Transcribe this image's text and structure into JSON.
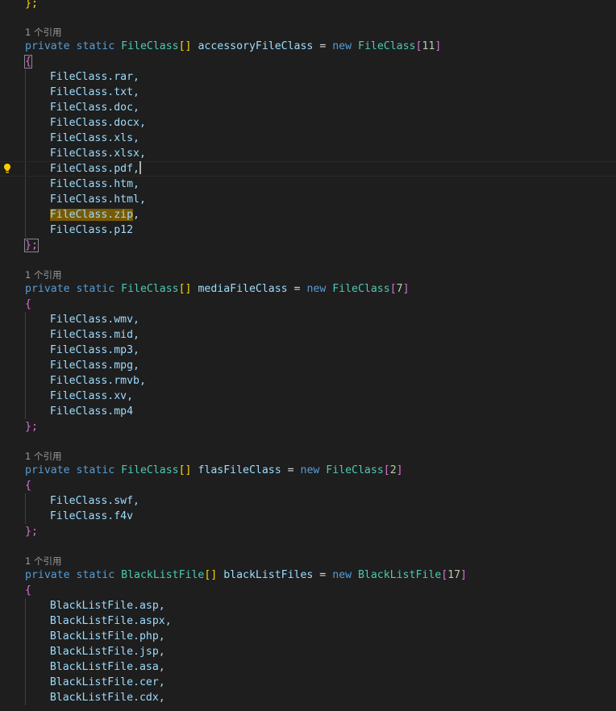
{
  "codelens": "1 个引用",
  "top_fragment": "};",
  "blocks": [
    {
      "decl": {
        "kw1": "private",
        "kw2": "static",
        "type": "FileClass",
        "arr": "[]",
        "name": "accessoryFileClass",
        "eq": "=",
        "kwnew": "new",
        "type2": "FileClass",
        "size": "11"
      },
      "open": "{",
      "items": [
        "FileClass.rar,",
        "FileClass.txt,",
        "FileClass.doc,",
        "FileClass.docx,",
        "FileClass.xls,",
        "FileClass.xlsx,",
        "FileClass.pdf,",
        "FileClass.htm,",
        "FileClass.html,",
        "FileClass.zip,",
        "FileClass.p12"
      ],
      "close": "};"
    },
    {
      "decl": {
        "kw1": "private",
        "kw2": "static",
        "type": "FileClass",
        "arr": "[]",
        "name": "mediaFileClass",
        "eq": "=",
        "kwnew": "new",
        "type2": "FileClass",
        "size": "7"
      },
      "open": "{",
      "items": [
        "FileClass.wmv,",
        "FileClass.mid,",
        "FileClass.mp3,",
        "FileClass.mpg,",
        "FileClass.rmvb,",
        "FileClass.xv,",
        "FileClass.mp4"
      ],
      "close": "};"
    },
    {
      "decl": {
        "kw1": "private",
        "kw2": "static",
        "type": "FileClass",
        "arr": "[]",
        "name": "flasFileClass",
        "eq": "=",
        "kwnew": "new",
        "type2": "FileClass",
        "size": "2"
      },
      "open": "{",
      "items": [
        "FileClass.swf,",
        "FileClass.f4v"
      ],
      "close": "};"
    },
    {
      "decl": {
        "kw1": "private",
        "kw2": "static",
        "type": "BlackListFile",
        "arr": "[]",
        "name": "blackListFiles",
        "eq": "=",
        "kwnew": "new",
        "type2": "BlackListFile",
        "size": "17"
      },
      "open": "{",
      "items": [
        "BlackListFile.asp,",
        "BlackListFile.aspx,",
        "BlackListFile.php,",
        "BlackListFile.jsp,",
        "BlackListFile.asa,",
        "BlackListFile.cer,",
        "BlackListFile.cdx,"
      ],
      "close": ""
    }
  ],
  "highlight_word": "FileClass.zip",
  "icons": {
    "lightbulb": "lightbulb-icon"
  },
  "colors": {
    "background": "#1e1e1e",
    "keyword": "#569cd6",
    "type": "#4ec9b0",
    "identifier": "#9cdcfe",
    "number": "#b5cea8",
    "bracket": "#da70d6",
    "highlight": "#7a5a00"
  }
}
